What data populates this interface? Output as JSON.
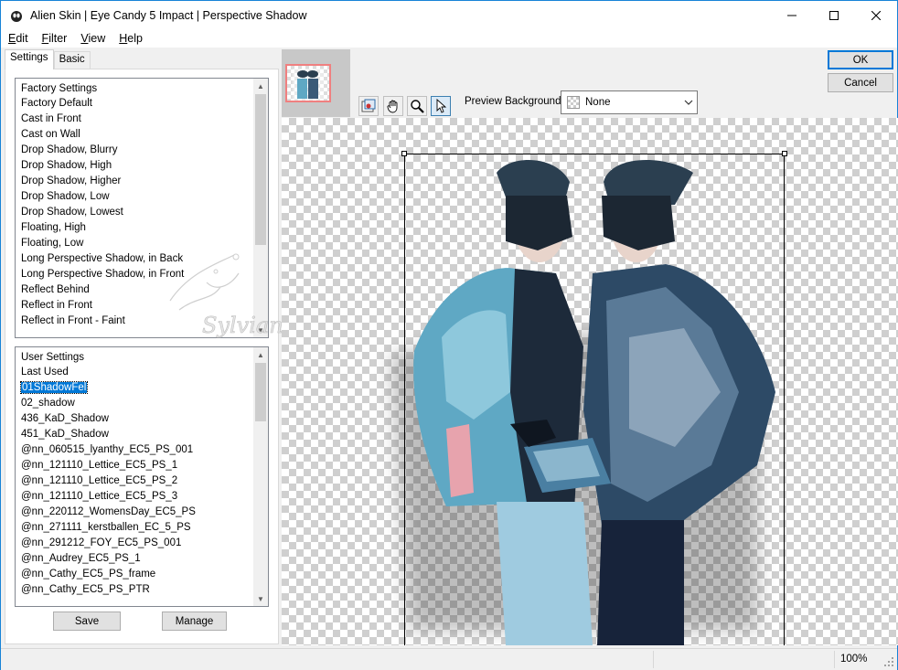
{
  "window": {
    "title": "Alien Skin | Eye Candy 5 Impact | Perspective Shadow"
  },
  "menu": [
    {
      "first": "E",
      "rest": "dit"
    },
    {
      "first": "F",
      "rest": "ilter"
    },
    {
      "first": "V",
      "rest": "iew"
    },
    {
      "first": "H",
      "rest": "elp"
    }
  ],
  "tabs": {
    "settings": "Settings",
    "basic": "Basic"
  },
  "factory": {
    "header": "Factory Settings",
    "items": [
      "Factory Default",
      "Cast in Front",
      "Cast on Wall",
      "Drop Shadow, Blurry",
      "Drop Shadow, High",
      "Drop Shadow, Higher",
      "Drop Shadow, Low",
      "Drop Shadow, Lowest",
      "Floating, High",
      "Floating, Low",
      "Long Perspective Shadow, in Back",
      "Long Perspective Shadow, in Front",
      "Reflect Behind",
      "Reflect in Front",
      "Reflect in Front - Faint"
    ]
  },
  "user": {
    "header": "User Settings",
    "selected": "01ShadowFel",
    "items": [
      "Last Used",
      "01ShadowFel",
      "02_shadow",
      "436_KaD_Shadow",
      "451_KaD_Shadow",
      "@nn_060515_lyanthy_EC5_PS_001",
      "@nn_121110_Lettice_EC5_PS_1",
      "@nn_121110_Lettice_EC5_PS_2",
      "@nn_121110_Lettice_EC5_PS_3",
      "@nn_220112_WomensDay_EC5_PS",
      "@nn_271111_kerstballen_EC_5_PS",
      "@nn_291212_FOY_EC5_PS_001",
      "@nn_Audrey_EC5_PS_1",
      "@nn_Cathy_EC5_PS_frame",
      "@nn_Cathy_EC5_PS_PTR"
    ]
  },
  "buttons": {
    "save": "Save",
    "manage": "Manage",
    "ok": "OK",
    "cancel": "Cancel"
  },
  "preview": {
    "label": "Preview Background:",
    "value": "None"
  },
  "watermark": "Sylviane",
  "status": {
    "zoom": "100%"
  },
  "colors": {
    "accent": "#0078d7",
    "coat_blue": "#5fa8c4",
    "hat_dark": "#2b3f50",
    "thumb_border": "#f08080"
  },
  "icons": [
    "app-icon",
    "minimize-icon",
    "maximize-icon",
    "close-icon",
    "navigator-icon",
    "hand-icon",
    "zoom-icon",
    "pointer-icon",
    "chevron-down-icon",
    "scroll-up-icon",
    "scroll-down-icon",
    "resize-grip-icon"
  ]
}
